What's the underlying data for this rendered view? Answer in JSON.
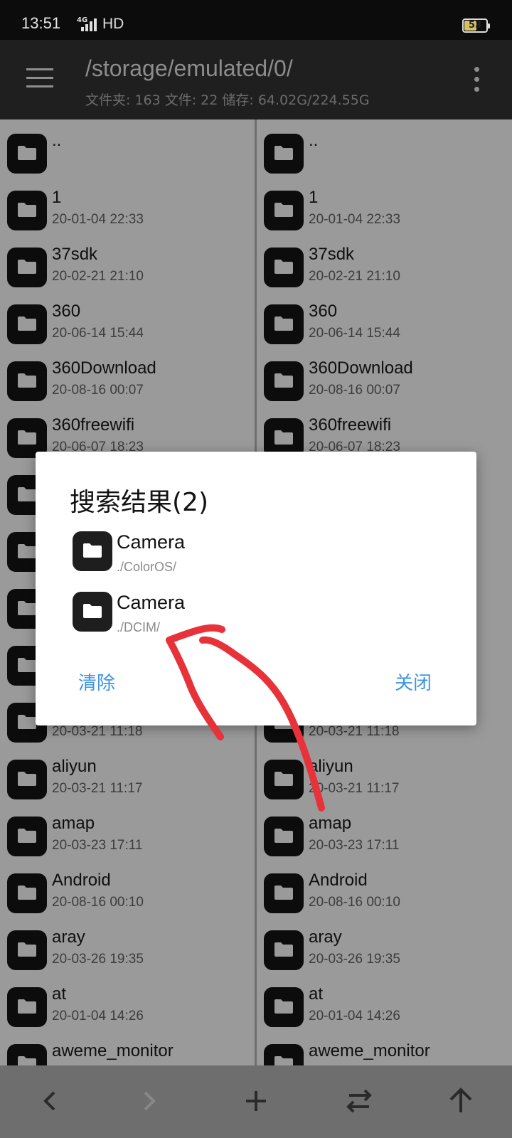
{
  "status_bar": {
    "time": "13:51",
    "network": "4G",
    "hd_label": "HD",
    "battery_percent": "53",
    "battery_level": 0.53
  },
  "toolbar": {
    "path": "/storage/emulated/0/",
    "stats": "文件夹: 163  文件: 22  储存: 64.02G/224.55G"
  },
  "colors": {
    "accent": "#3b96e3",
    "annotation": "#e8323a",
    "toolbar_bg": "#1f1f1f"
  },
  "files": [
    {
      "name": "..",
      "date": ""
    },
    {
      "name": "1",
      "date": "20-01-04 22:33"
    },
    {
      "name": "37sdk",
      "date": "20-02-21 21:10"
    },
    {
      "name": "360",
      "date": "20-06-14 15:44"
    },
    {
      "name": "360Download",
      "date": "20-08-16 00:07"
    },
    {
      "name": "360freewifi",
      "date": "20-06-07 18:23"
    },
    {
      "name": "",
      "date": ""
    },
    {
      "name": "",
      "date": ""
    },
    {
      "name": "",
      "date": ""
    },
    {
      "name": "",
      "date": ""
    },
    {
      "name": "",
      "date": "20-03-21 11:18"
    },
    {
      "name": "aliyun",
      "date": "20-03-21 11:17"
    },
    {
      "name": "amap",
      "date": "20-03-23 17:11"
    },
    {
      "name": "Android",
      "date": "20-08-16 00:10"
    },
    {
      "name": "aray",
      "date": "20-03-26 19:35"
    },
    {
      "name": "at",
      "date": "20-01-04 14:26"
    },
    {
      "name": "aweme_monitor",
      "date": ""
    }
  ],
  "dialog": {
    "title": "搜索结果(2)",
    "results": [
      {
        "name": "Camera",
        "path": "./ColorOS/"
      },
      {
        "name": "Camera",
        "path": "./DCIM/"
      }
    ],
    "clear_label": "清除",
    "close_label": "关闭"
  },
  "bottom_bar": {
    "icons": [
      "chevron-left-icon",
      "chevron-right-icon",
      "plus-icon",
      "swap-icon",
      "arrow-up-icon"
    ]
  }
}
